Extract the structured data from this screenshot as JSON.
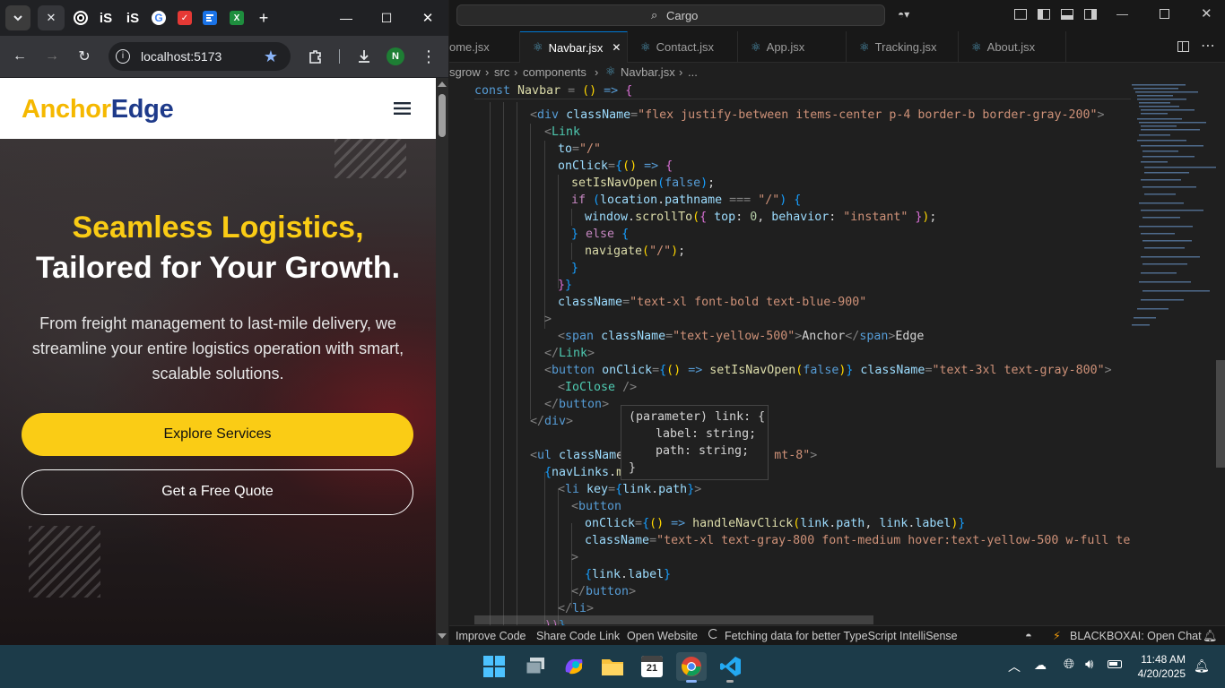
{
  "browser": {
    "tabs": [
      "iS",
      "iS",
      "G",
      "✓",
      "X"
    ],
    "new_tab": "+",
    "url": "localhost:5173",
    "avatar_letter": "N",
    "window_min": "—",
    "window_max": "☐",
    "window_close": "✕"
  },
  "site": {
    "logo_part1": "Anchor",
    "logo_part2": "Edge",
    "hero_title_line1": "Seamless Logistics,",
    "hero_title_line2": "Tailored for Your Growth.",
    "hero_subtitle": "From freight management to last-mile delivery, we streamline your entire logistics operation with smart, scalable solutions.",
    "cta_primary": "Explore Services",
    "cta_secondary": "Get a Free Quote",
    "colors": {
      "yellow": "#facc15",
      "blue": "#1e3a8a"
    }
  },
  "vscode": {
    "search": "Cargo",
    "tabs": [
      {
        "label": "ome.jsx",
        "active": false
      },
      {
        "label": "Navbar.jsx",
        "active": true
      },
      {
        "label": "Contact.jsx",
        "active": false
      },
      {
        "label": "App.jsx",
        "active": false
      },
      {
        "label": "Tracking.jsx",
        "active": false
      },
      {
        "label": "About.jsx",
        "active": false
      }
    ],
    "breadcrumbs": [
      "sgrow",
      "src",
      "components",
      "Navbar.jsx",
      "..."
    ],
    "hover": {
      "line1": "(parameter) link: {",
      "line2": "label: string;",
      "line3": "path: string;",
      "line4": "}"
    },
    "status": {
      "improve_code": "Improve Code",
      "share_link": "Share Code Link",
      "open_website": "Open Website",
      "fetching": "Fetching data for better TypeScript IntelliSense",
      "blackbox": "BLACKBOXAI: Open Chat"
    }
  },
  "taskbar": {
    "time": "11:48 AM",
    "date": "4/20/2025",
    "calendar_day": "21"
  }
}
